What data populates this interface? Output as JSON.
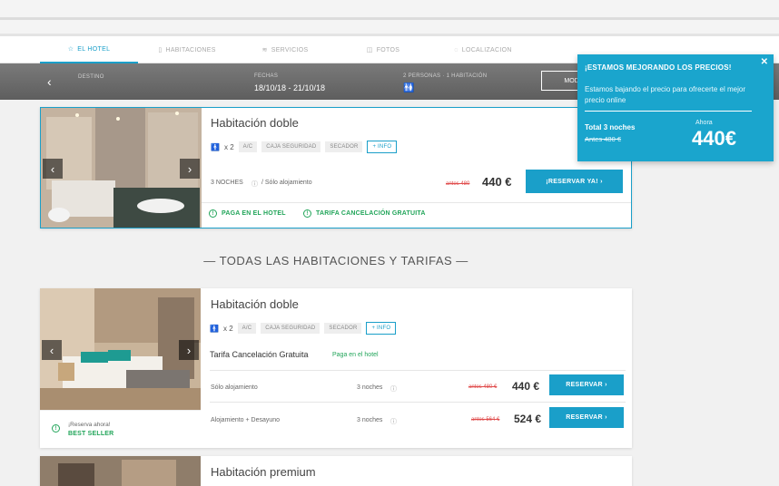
{
  "tabs": [
    {
      "icon": "☆",
      "label": "EL HOTEL",
      "active": true
    },
    {
      "icon": "▯",
      "label": "HABITACIONES"
    },
    {
      "icon": "≋",
      "label": "SERVICIOS"
    },
    {
      "icon": "◫",
      "label": "FOTOS"
    },
    {
      "icon": "◌",
      "label": "LOCALIZACION"
    }
  ],
  "search": {
    "destino_label": "DESTINO",
    "fechas_label": "FECHAS",
    "fechas_value": "18/10/18 - 21/10/18",
    "personas_label": "2 PERSONAS · 1 HABITACIÓN",
    "modify": "MODIFICAR"
  },
  "featured": {
    "title": "Habitación doble",
    "pax": "x 2",
    "chips": [
      "A/C",
      "CAJA SEGURIDAD",
      "SECADOR"
    ],
    "info": "+ INFO",
    "nights": "3 NOCHES",
    "plan": "/ Sólo alojamiento",
    "old_price": "antes 480",
    "price": "440 €",
    "button": "¡RESERVAR YA! ›",
    "pay_hotel": "PAGA EN EL HOTEL",
    "free_cancel": "TARIFA CANCELACIÓN GRATUITA"
  },
  "section_title": "— TODAS LAS HABITACIONES Y TARIFAS —",
  "room1": {
    "title": "Habitación doble",
    "pax": "x 2",
    "chips": [
      "A/C",
      "CAJA SEGURIDAD",
      "SECADOR"
    ],
    "info": "+ INFO",
    "rate_name": "Tarifa Cancelación Gratuita",
    "rate_tag": "Paga en el hotel",
    "rows": [
      {
        "plan": "Sólo alojamiento",
        "nights": "3 noches",
        "old": "antes 480 €",
        "price": "440 €",
        "button": "RESERVAR ›"
      },
      {
        "plan": "Alojamiento + Desayuno",
        "nights": "3 noches",
        "old": "antes 564 €",
        "price": "524 €",
        "button": "RESERVAR ›"
      }
    ],
    "reserve_now": "¡Reserva ahora!",
    "best_seller": "BEST SELLER"
  },
  "room2": {
    "title": "Habitación premium"
  },
  "popup": {
    "title": "¡ESTAMOS MEJORANDO LOS PRECIOS!",
    "text": "Estamos bajando el precio para ofrecerte el mejor precio online",
    "total_label": "Total 3 noches",
    "antes": "Antes 480 €",
    "ahora_label": "Ahora",
    "ahora_price": "440€",
    "close": "✕"
  },
  "colors": {
    "accent": "#1a9fc9",
    "popup": "#1aa5cd",
    "green": "#22a55a",
    "strike": "#e04b4b"
  }
}
